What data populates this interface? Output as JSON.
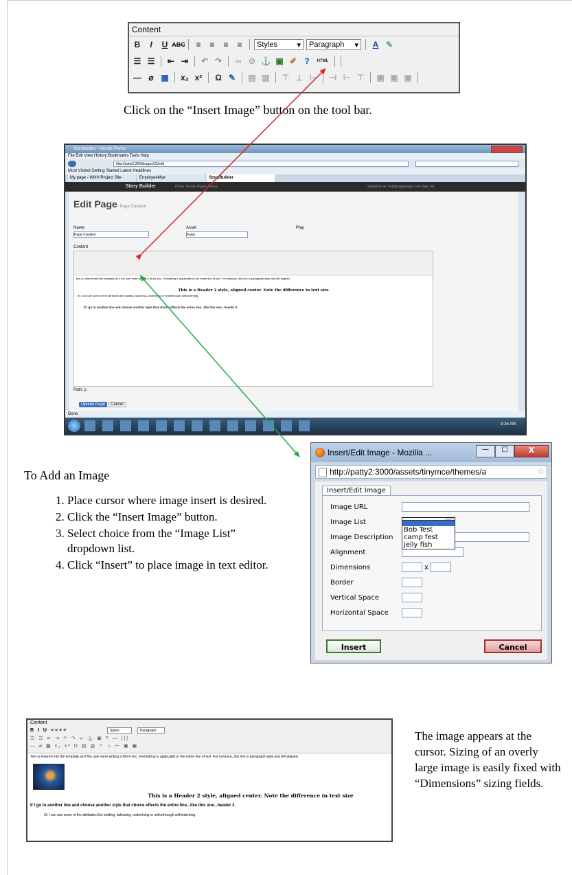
{
  "toolbar": {
    "title": "Content",
    "styles_label": "Styles",
    "format_label": "Paragraph",
    "html_label": "HTML"
  },
  "caption1": "Click on the “Insert Image” button on the tool bar.",
  "browser": {
    "window_title": "StoryBuilder - Mozilla Firefox",
    "menu": "File  Edit  View  History  Bookmarks  Tools  Help",
    "url": "http://patty2:3000/pages/25/edit",
    "bookmarks": "Most Visited   Getting Started   Latest Headlines",
    "tabs": [
      "My page - WNH Project Site",
      "EmployeeMax",
      "StoryBuilder"
    ],
    "app_name": "Story Builder",
    "nav": "Home   Stories   Pages   Assets",
    "signed_in": "Signed in as: bob@eggbeagle.com      Sign out",
    "page_heading": "Edit Page",
    "page_subheading": "Page Creation",
    "name_label": "Name",
    "name_value": "Page Creation",
    "asset_label": "Asset",
    "asset_value": "False",
    "play_label": "Play",
    "content_label": "Content",
    "body_line1": "Text is entered into the template as if the user were writing a Word doc. Formatting is applicable to the entire line of text. For instance, this line is paragraph style and left aligned.",
    "body_h2": "This is a Header 2 style, aligned center.  Note the difference in text size",
    "body_line2": "Or I can use some of the attributes like bolding, italicizing, underlining or strikethrough withindenting.",
    "body_h3": "If I go to another line and choose another style that choice effects the entire line...like this one...header 3.",
    "path_label": "Path: p",
    "update_button": "Update Page",
    "cancel_button": "Cancel",
    "status": "Done",
    "clock": "9:26 AM"
  },
  "steps": {
    "heading": "To Add an Image",
    "items": [
      "Place cursor where image insert is desired.",
      "Click the “Insert Image” button.",
      "Select choice from the “Image List” dropdown list.",
      "Click “Insert” to place image in text editor."
    ]
  },
  "dialog": {
    "title": "Insert/Edit Image - Mozilla ...",
    "url": "http://patty2:3000/assets/tinymce/themes/a",
    "tab": "Insert/Edit Image",
    "labels": [
      "Image URL",
      "Image List",
      "Image Description",
      "Alignment",
      "Dimensions",
      "Border",
      "Vertical Space",
      "Horizontal Space"
    ],
    "dim_x": "x",
    "list_options": [
      "Bob Test",
      "camp fest",
      "jelly fish"
    ],
    "insert_button": "Insert",
    "cancel_button": "Cancel"
  },
  "result": {
    "title": "Content",
    "styles_label": "Styles",
    "format_label": "Paragraph",
    "line1": "Text is entered into the template as if the user were writing a Word doc. Formatting is applicable to the entire line of text. For instance, this line is paragraph style and left aligned.",
    "h2": "This is a Header 2 style, aligned center.  Note the difference in text size",
    "h3": "If I go to another line and choose another style that choice effects the entire line...like this one...header 3.",
    "line2": "Or I can use some of the attributes like bolding, italicizing, underlining or strikethrough withindenting."
  },
  "caption2": "The image appears at the cursor. Sizing of an overly large image is easily fixed with “Dimensions” sizing fields.",
  "colors": {
    "arrow_red": "#e02020",
    "arrow_green": "#22aa44",
    "green_text": "#2a9a3a",
    "red_text": "#e03030",
    "nav_dark": "#2b2b2b"
  }
}
